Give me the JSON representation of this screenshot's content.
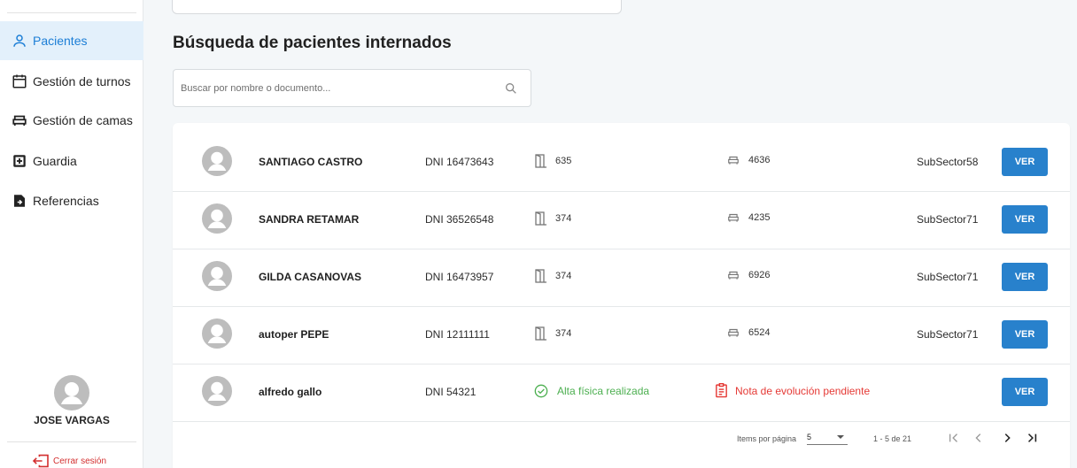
{
  "sidebar": {
    "items": [
      {
        "label": "Pacientes",
        "icon": "person-icon",
        "active": true
      },
      {
        "label": "Gestión de turnos",
        "icon": "calendar-icon",
        "active": false
      },
      {
        "label": "Gestión de camas",
        "icon": "bed-icon",
        "active": false
      },
      {
        "label": "Guardia",
        "icon": "plus-box-icon",
        "active": false
      },
      {
        "label": "Referencias",
        "icon": "document-reference-icon",
        "active": false
      }
    ],
    "user": {
      "name": "JOSE VARGAS"
    },
    "logout_label": "Cerrar sesión"
  },
  "main": {
    "title": "Búsqueda de pacientes internados",
    "search": {
      "placeholder": "Buscar por nombre o documento...",
      "value": ""
    },
    "patients": [
      {
        "name": "SANTIAGO CASTRO",
        "dni": "DNI 16473643",
        "room": "635",
        "bed": "4636",
        "sector": "SubSector58",
        "button": "VER"
      },
      {
        "name": "SANDRA RETAMAR",
        "dni": "DNI 36526548",
        "room": "374",
        "bed": "4235",
        "sector": "SubSector71",
        "button": "VER"
      },
      {
        "name": "GILDA CASANOVAS",
        "dni": "DNI 16473957",
        "room": "374",
        "bed": "6926",
        "sector": "SubSector71",
        "button": "VER"
      },
      {
        "name": "autoper PEPE",
        "dni": "DNI 12111111",
        "room": "374",
        "bed": "6524",
        "sector": "SubSector71",
        "button": "VER"
      },
      {
        "name": "alfredo gallo",
        "dni": "DNI 54321",
        "alta": "Alta física realizada",
        "nota": "Nota de evolución pendiente",
        "button": "VER"
      }
    ],
    "paginator": {
      "items_per_page_label": "Items por página",
      "items_per_page_value": "5",
      "range": "1 - 5 de 21"
    }
  },
  "colors": {
    "accent": "#2881cc",
    "active_bg": "#e3f0fb",
    "success": "#4caf50",
    "danger": "#e53935"
  }
}
